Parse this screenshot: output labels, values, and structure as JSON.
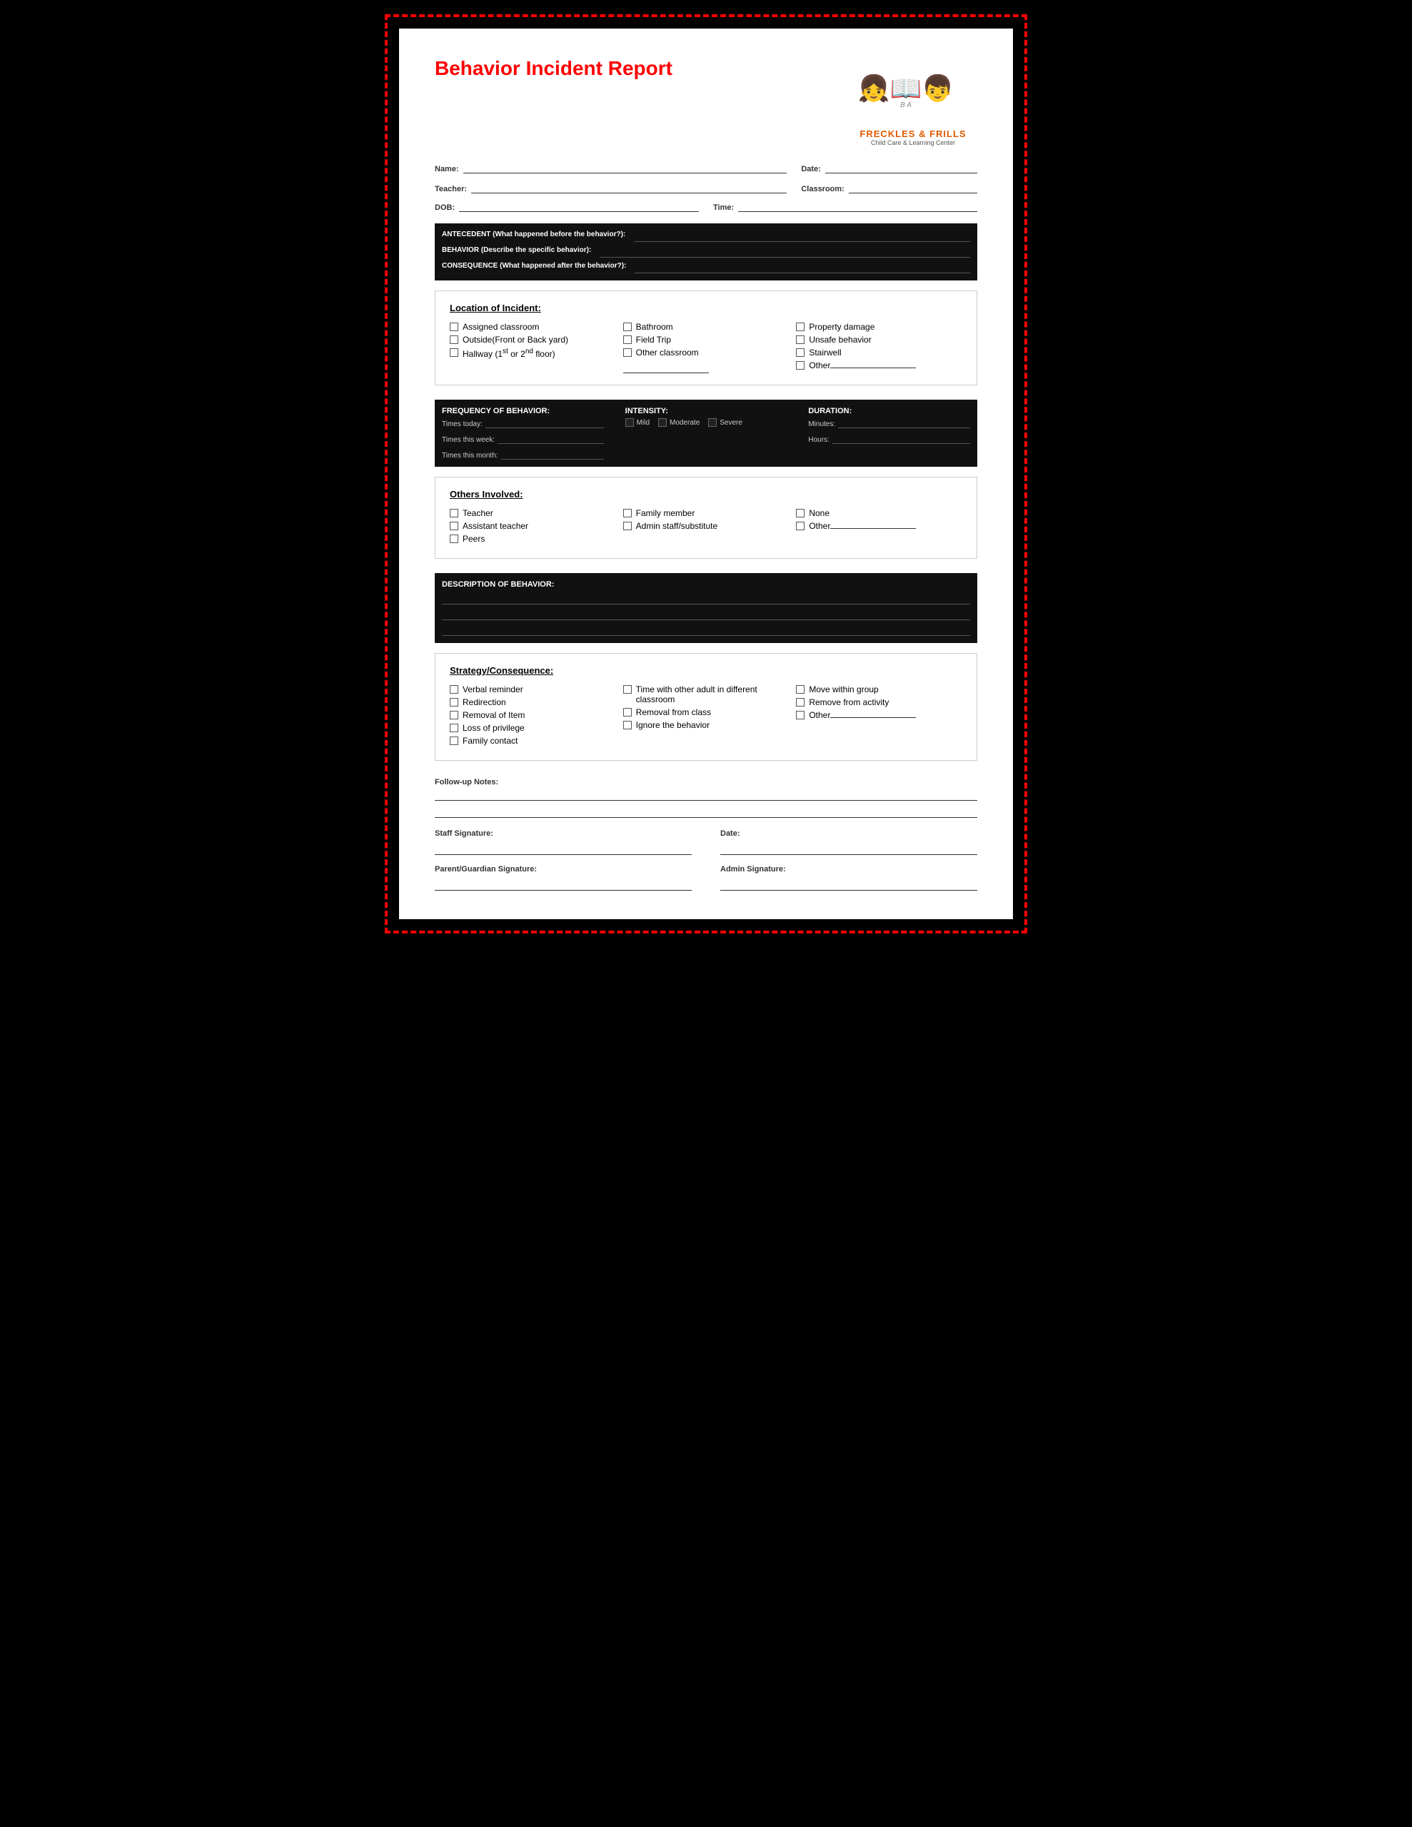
{
  "title": "Behavior Incident Report",
  "logo": {
    "name": "FRECKLES & FRILLS",
    "subtitle": "Child Care & Learning Center",
    "emoji": "👧📚👦"
  },
  "form": {
    "name_label": "Name:",
    "date_label": "Date:",
    "teacher_label": "Teacher:",
    "classroom_label": "Classroom:",
    "dob_label": "DOB:",
    "time_label": "Time:",
    "location_of_incident_label": "Location of Incident:",
    "others_involved_label": "Others Involved:",
    "strategy_consequence_label": "Strategy/Consequence:"
  },
  "location": {
    "col1": [
      "Assigned classroom",
      "Outside(Front or Back yard)",
      "Hallway (1st or 2nd floor)"
    ],
    "col2": [
      "Bathroom",
      "Field Trip",
      "Other classroom"
    ],
    "col3": [
      "Property damage",
      "Unsafe behavior",
      "Stairwell",
      "Other"
    ]
  },
  "others_involved": {
    "col1": [
      "Teacher",
      "Assistant teacher",
      "Peers"
    ],
    "col2": [
      "Family member",
      "Admin staff/substitute"
    ],
    "col3": [
      "None",
      "Other"
    ]
  },
  "strategy": {
    "col1": [
      "Verbal reminder",
      "Redirection",
      "Removal of Item",
      "Loss of privilege",
      "Family contact"
    ],
    "col2": [
      "Time with other adult in different classroom",
      "Removal from class",
      "Ignore the behavior"
    ],
    "col3": [
      "Move within group",
      "Remove from activity",
      "Other"
    ]
  },
  "dark_sections": {
    "antecedent_label": "ANTECEDENT (What happened before the behavior?):",
    "behavior_label": "BEHAVIOR (Describe the specific behavior):",
    "consequence_label": "CONSEQUENCE (What happened after the behavior?):",
    "frequency_label": "FREQUENCY OF BEHAVIOR:",
    "intensity_label": "INTENSITY:",
    "duration_label": "DURATION:",
    "sub_labels": {
      "times_today": "Times today:",
      "times_week": "Times this week:",
      "times_month": "Times this month:",
      "mild": "Mild",
      "moderate": "Moderate",
      "severe": "Severe",
      "minutes": "Minutes:",
      "hours": "Hours:"
    }
  },
  "signature": {
    "staff_sig_label": "Staff Signature:",
    "parent_sig_label": "Parent/Guardian Signature:",
    "date_label": "Date:",
    "admin_label": "Admin Signature:",
    "follow_up_label": "Follow-up Notes:"
  }
}
